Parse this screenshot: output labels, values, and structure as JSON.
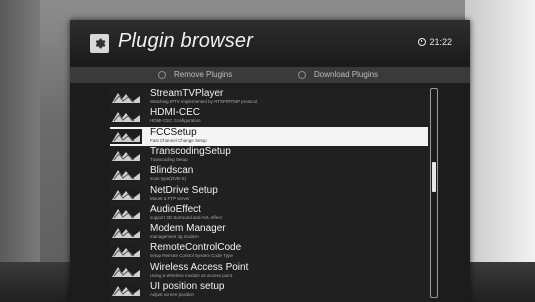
{
  "header": {
    "title": "Plugin browser",
    "icon": "gear-icon",
    "clock": "21:22"
  },
  "tabs": [
    {
      "label": "Remove Plugins"
    },
    {
      "label": "Download Plugins"
    }
  ],
  "plugins": {
    "selected_index": 2,
    "items": [
      {
        "name": "StreamTVPlayer",
        "desc": "Watching IPTV implemented by RTSP/RTMP protocol."
      },
      {
        "name": "HDMI-CEC",
        "desc": "HDMI-CEC Configuration"
      },
      {
        "name": "FCCSetup",
        "desc": "Fast Channel Change Setup"
      },
      {
        "name": "TranscodingSetup",
        "desc": "Transcoding Setup"
      },
      {
        "name": "Blindscan",
        "desc": "scan type(DVB-S)"
      },
      {
        "name": "NetDrive Setup",
        "desc": "Mount a FTP server"
      },
      {
        "name": "AudioEffect",
        "desc": "support 3D Surround and AVL effect"
      },
      {
        "name": "Modem Manager",
        "desc": "management 3g modem"
      },
      {
        "name": "RemoteControlCode",
        "desc": "setup Remote Control System Code Type"
      },
      {
        "name": "Wireless Access Point",
        "desc": "Using a Wireless module as access point."
      },
      {
        "name": "UI position setup",
        "desc": "Adjust screen position"
      }
    ]
  },
  "scrollbar": {
    "position_fraction": 0.41
  },
  "colors": {
    "window_bg": "#1c1c1c",
    "selection_bg": "#f4f4f4",
    "text": "#f2f2f2"
  }
}
